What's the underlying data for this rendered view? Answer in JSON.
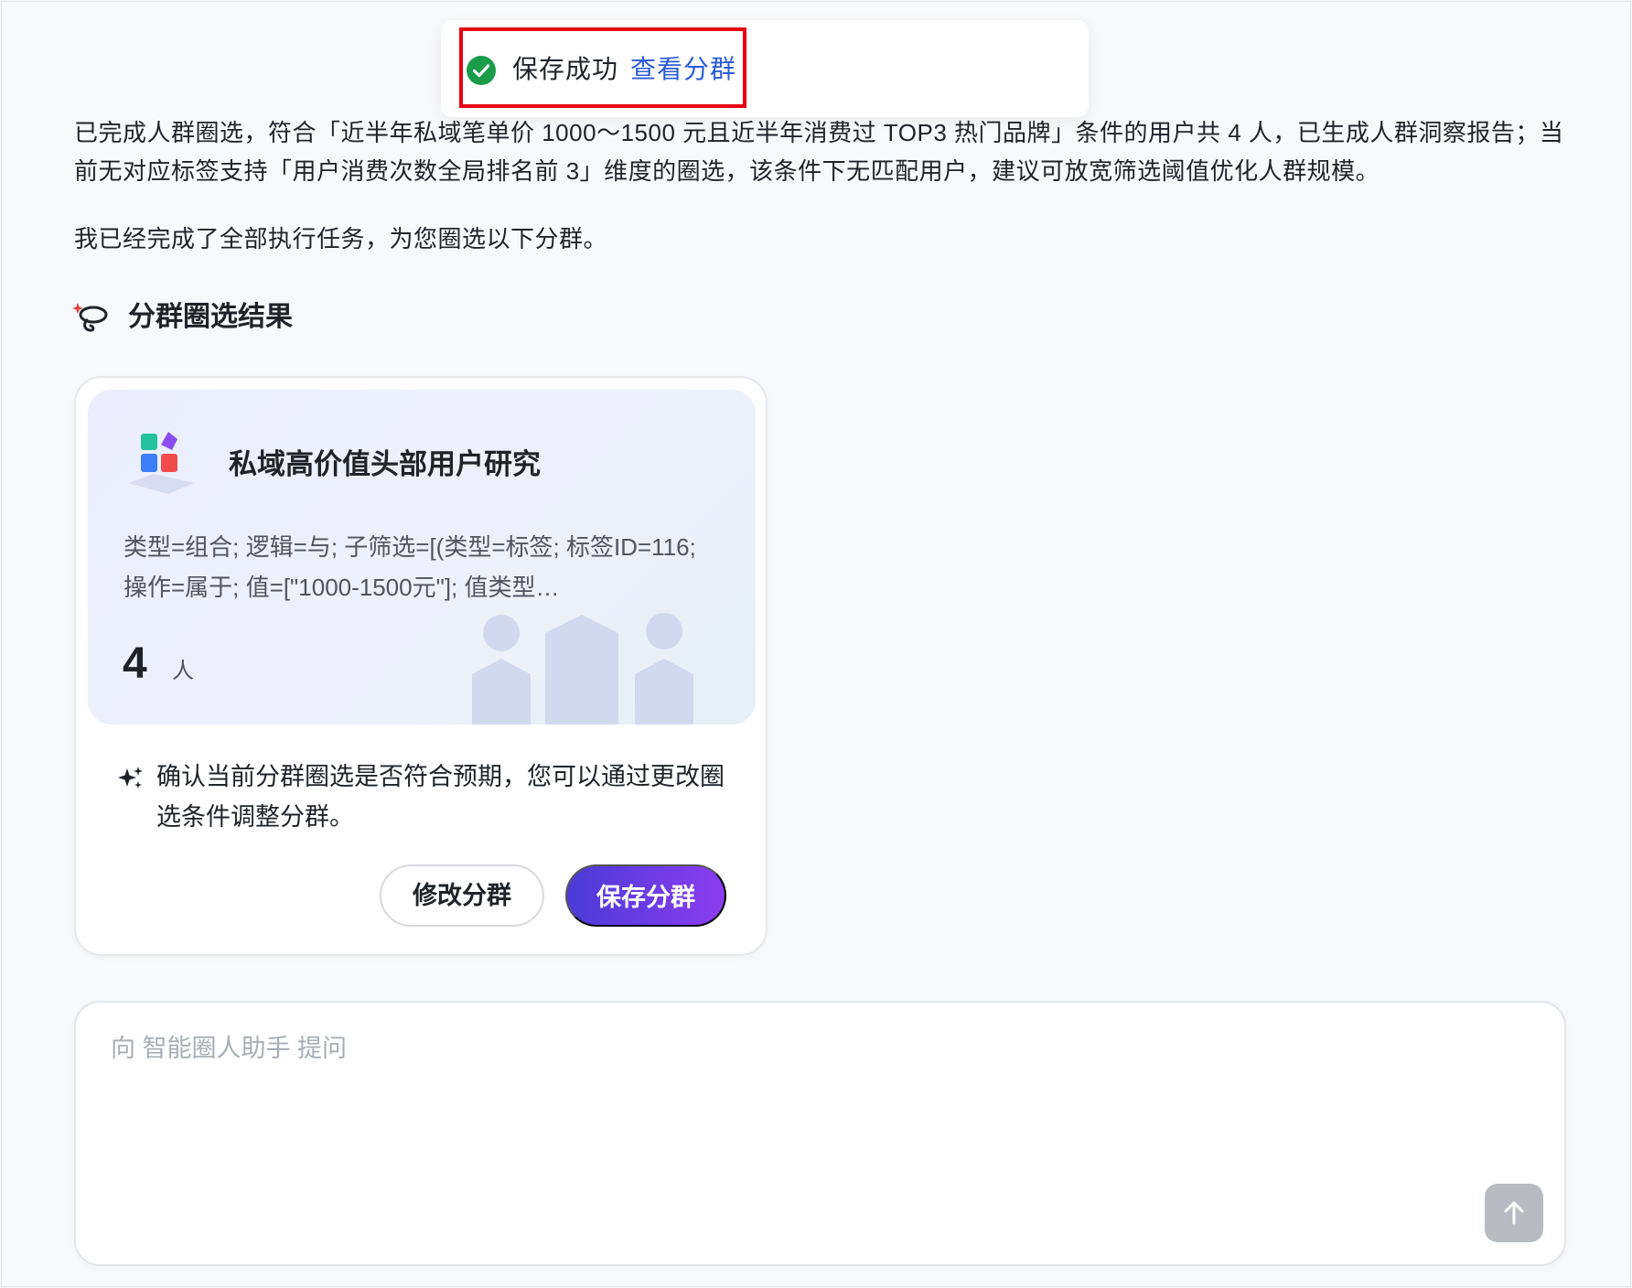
{
  "toast": {
    "message": "保存成功",
    "link_label": "查看分群",
    "success_color": "#1a9c4a",
    "icon": "check-circle-icon"
  },
  "messages": {
    "summary": "已完成人群圈选，符合「近半年私域笔单价 1000～1500 元且近半年消费过 TOP3 热门品牌」条件的用户共 4 人，已生成人群洞察报告；当前无对应标签支持「用户消费次数全局排名前 3」维度的圈选，该条件下无匹配用户，建议可放宽筛选阈值优化人群规模。",
    "done": "我已经完成了全部执行任务，为您圈选以下分群。"
  },
  "section": {
    "title": "分群圈选结果",
    "icon": "lasso-sparkle-icon"
  },
  "segment": {
    "name": "私域高价值头部用户研究",
    "condition": "类型=组合; 逻辑=与; 子筛选=[(类型=标签; 标签ID=116; 操作=属于; 值=[\"1000-1500元\"]; 值类型…",
    "count": "4",
    "unit": "人",
    "icon": "segment-blocks-icon",
    "hint": "确认当前分群圈选是否符合预期，您可以通过更改圈选条件调整分群。",
    "edit_label": "修改分群",
    "save_label": "保存分群"
  },
  "composer": {
    "placeholder": "向 智能圈人助手 提问",
    "send_icon": "arrow-up-icon"
  },
  "colors": {
    "accent_start": "#4a3bd6",
    "accent_end": "#8b3cf0",
    "link": "#2a5bd7",
    "highlight_border": "#e60012"
  }
}
